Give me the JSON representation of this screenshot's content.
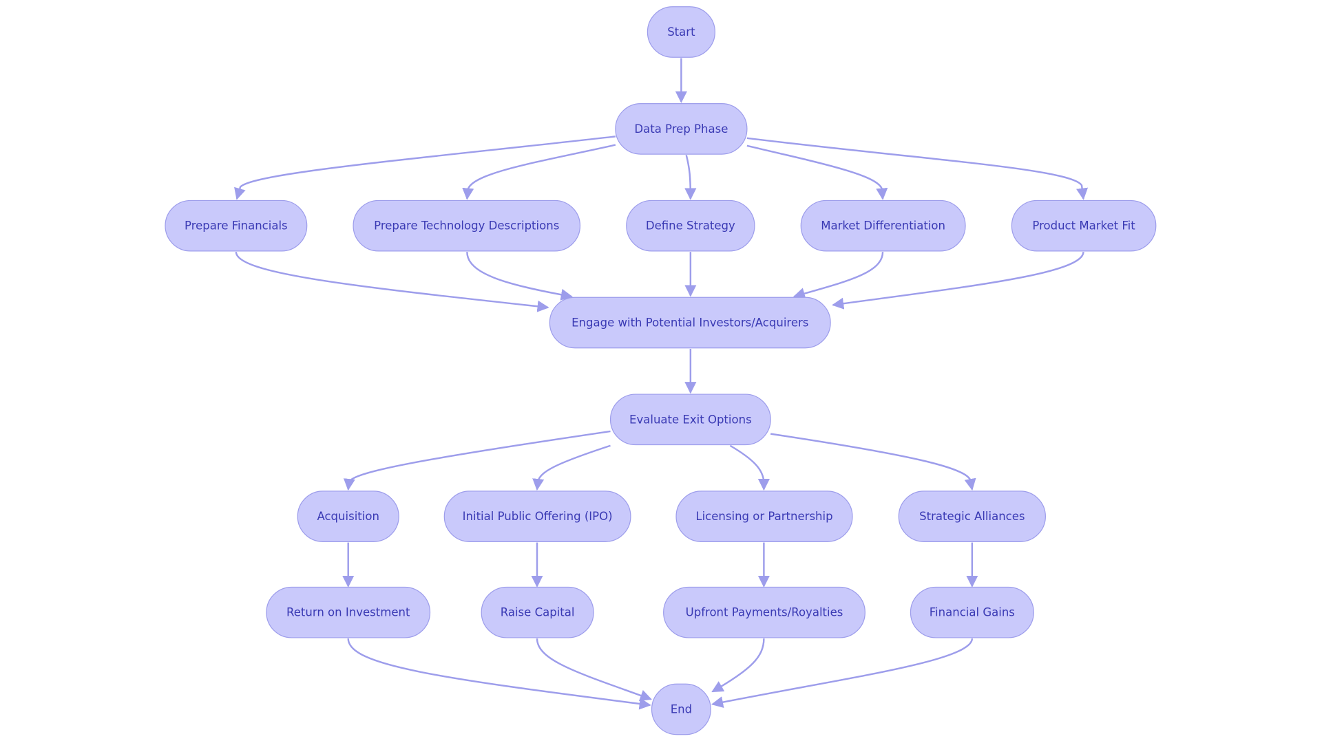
{
  "colors": {
    "node_fill": "#c9c9fb",
    "node_stroke": "#9d9deb",
    "text": "#3a3ab4",
    "edge": "#9d9deb",
    "background": "#ffffff"
  },
  "nodes": [
    {
      "id": "start",
      "label": "Start"
    },
    {
      "id": "dataprep",
      "label": "Data Prep Phase"
    },
    {
      "id": "prepfin",
      "label": "Prepare Financials"
    },
    {
      "id": "preptech",
      "label": "Prepare Technology Descriptions"
    },
    {
      "id": "defstrat",
      "label": "Define Strategy"
    },
    {
      "id": "marketdiff",
      "label": "Market Differentiation"
    },
    {
      "id": "pmf",
      "label": "Product Market Fit"
    },
    {
      "id": "engage",
      "label": "Engage with Potential Investors/Acquirers"
    },
    {
      "id": "evaluate",
      "label": "Evaluate Exit Options"
    },
    {
      "id": "acq",
      "label": "Acquisition"
    },
    {
      "id": "ipo",
      "label": "Initial Public Offering (IPO)"
    },
    {
      "id": "lic",
      "label": "Licensing or Partnership"
    },
    {
      "id": "sa",
      "label": "Strategic Alliances"
    },
    {
      "id": "roi",
      "label": "Return on Investment"
    },
    {
      "id": "raise",
      "label": "Raise Capital"
    },
    {
      "id": "upfront",
      "label": "Upfront Payments/Royalties"
    },
    {
      "id": "fin",
      "label": "Financial Gains"
    },
    {
      "id": "end",
      "label": "End"
    }
  ],
  "edges": [
    {
      "from": "start",
      "to": "dataprep"
    },
    {
      "from": "dataprep",
      "to": "prepfin"
    },
    {
      "from": "dataprep",
      "to": "preptech"
    },
    {
      "from": "dataprep",
      "to": "defstrat"
    },
    {
      "from": "dataprep",
      "to": "marketdiff"
    },
    {
      "from": "dataprep",
      "to": "pmf"
    },
    {
      "from": "prepfin",
      "to": "engage"
    },
    {
      "from": "preptech",
      "to": "engage"
    },
    {
      "from": "defstrat",
      "to": "engage"
    },
    {
      "from": "marketdiff",
      "to": "engage"
    },
    {
      "from": "pmf",
      "to": "engage"
    },
    {
      "from": "engage",
      "to": "evaluate"
    },
    {
      "from": "evaluate",
      "to": "acq"
    },
    {
      "from": "evaluate",
      "to": "ipo"
    },
    {
      "from": "evaluate",
      "to": "lic"
    },
    {
      "from": "evaluate",
      "to": "sa"
    },
    {
      "from": "acq",
      "to": "roi"
    },
    {
      "from": "ipo",
      "to": "raise"
    },
    {
      "from": "lic",
      "to": "upfront"
    },
    {
      "from": "sa",
      "to": "fin"
    },
    {
      "from": "roi",
      "to": "end"
    },
    {
      "from": "raise",
      "to": "end"
    },
    {
      "from": "upfront",
      "to": "end"
    },
    {
      "from": "fin",
      "to": "end"
    }
  ]
}
